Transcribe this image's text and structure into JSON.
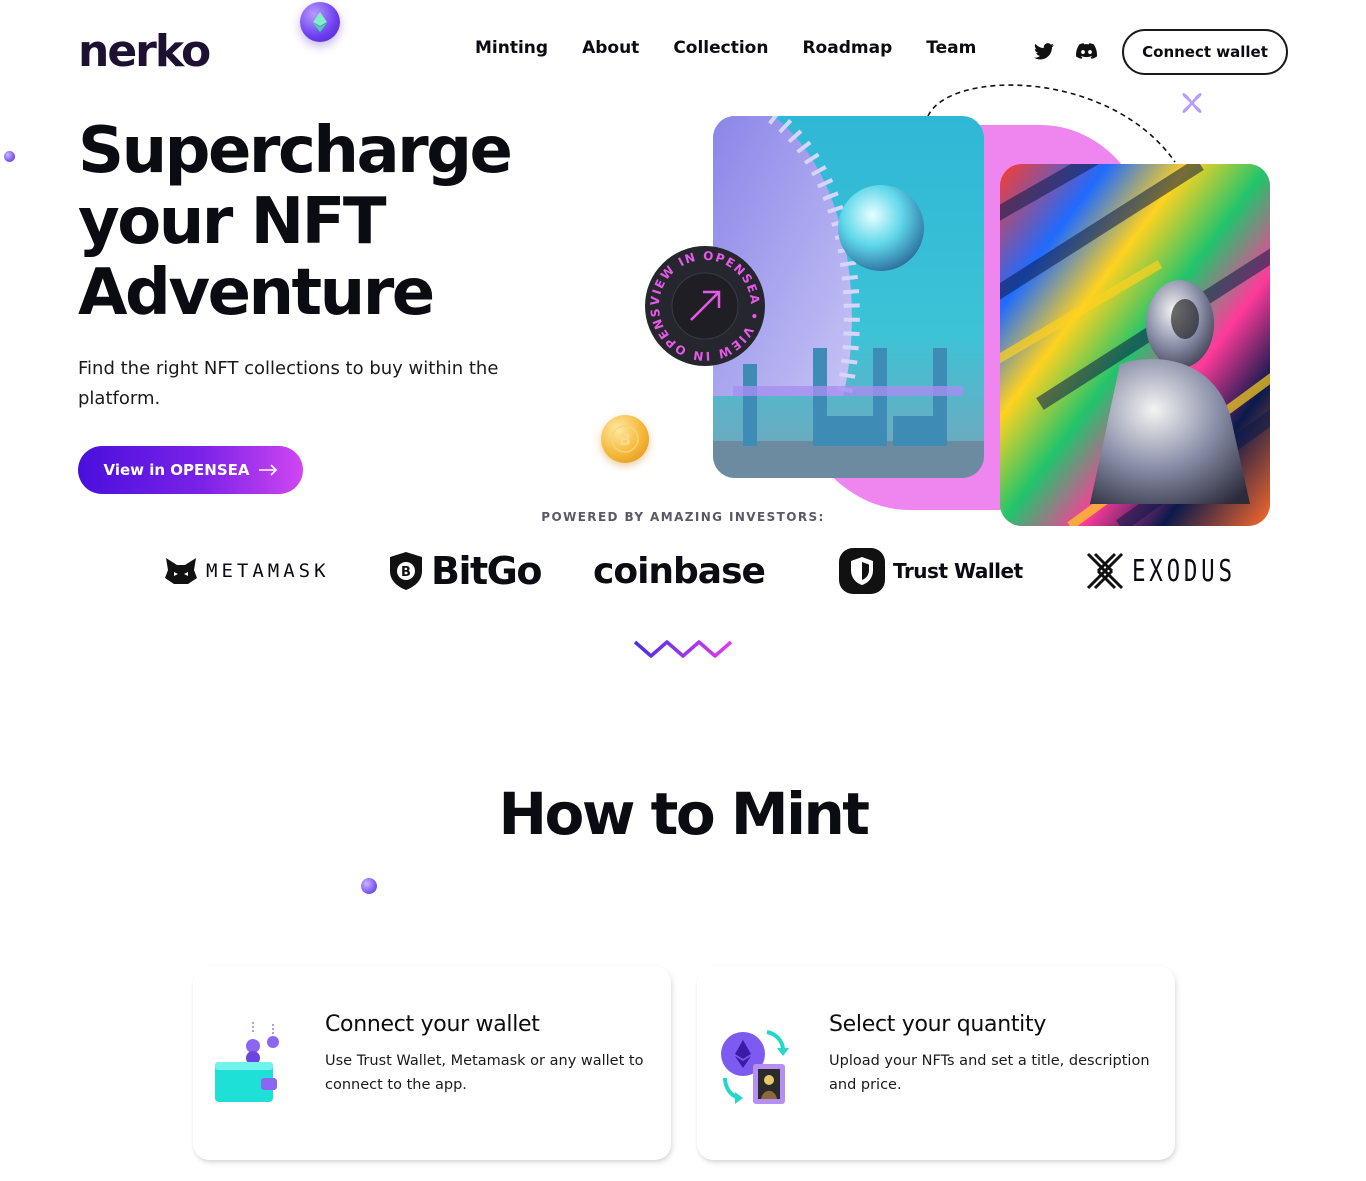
{
  "header": {
    "logo": "nerko",
    "nav": [
      {
        "label": "Minting"
      },
      {
        "label": "About"
      },
      {
        "label": "Collection"
      },
      {
        "label": "Roadmap"
      },
      {
        "label": "Team"
      }
    ],
    "social": [
      "twitter-icon",
      "discord-icon"
    ],
    "connect_label": "Connect wallet"
  },
  "hero": {
    "title_lines": [
      "Supercharge",
      "your NFT",
      "Adventure"
    ],
    "subtitle": "Find the right NFT collections to buy within the platform.",
    "cta_label": "View in OPENSEA",
    "badge_text": "VIEW IN OPENSEA • VIEW IN OPENSEA •"
  },
  "investors": {
    "heading": "POWERED BY AMAZING INVESTORS:",
    "brands": [
      {
        "name": "METAMASK",
        "icon": "fox-icon"
      },
      {
        "name": "BitGo",
        "icon": "shield-bitcoin-icon"
      },
      {
        "name": "coinbase",
        "icon": ""
      },
      {
        "name": "Trust Wallet",
        "icon": "shield-icon"
      },
      {
        "name": "EXODUS",
        "icon": "exodus-x-icon"
      }
    ]
  },
  "mint": {
    "title": "How to Mint",
    "steps": [
      {
        "title": "Connect your wallet",
        "text": "Use Trust Wallet, Metamask or any wallet to connect to the app.",
        "icon": "wallet-icon"
      },
      {
        "title": "Select your quantity",
        "text": "Upload your NFTs and set a title, description and price.",
        "icon": "nft-swap-icon"
      }
    ]
  },
  "colors": {
    "accent_purple": "#4a0fdc",
    "accent_pink": "#d046f2",
    "blob_pink": "#ef86f0",
    "teal": "#2fb7d6"
  }
}
